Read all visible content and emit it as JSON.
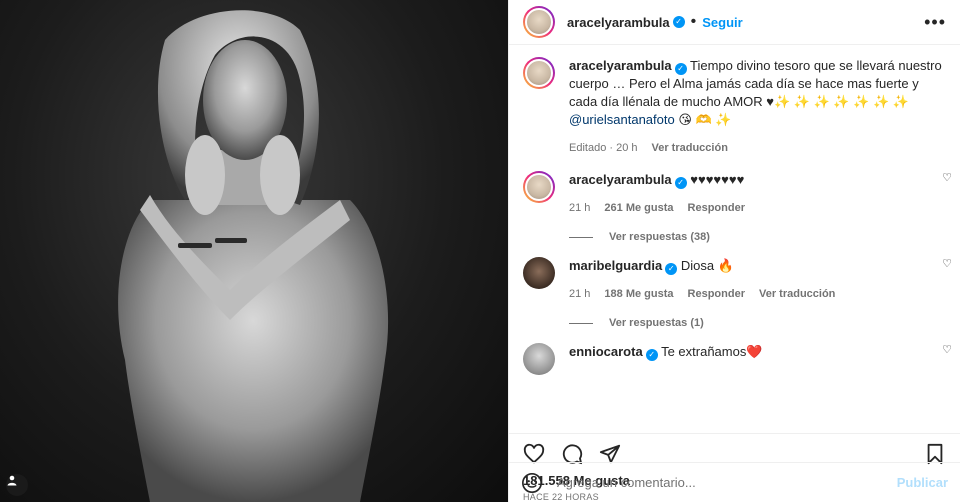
{
  "post": {
    "author": "aracelyarambula",
    "follow_label": "Seguir",
    "more_label": "•••"
  },
  "caption": {
    "author": "aracelyarambula",
    "text": "Tiempo divino tesoro que se llevará nuestro cuerpo … Pero el Alma jamás cada día se hace mas fuerte y cada día llénala de mucho AMOR ♥✨ ✨ ✨ ✨ ✨ ✨ ✨",
    "mention": "@urielsantanafoto",
    "emojis": " 😘 🫶 ✨",
    "edited": "Editado · 20 h",
    "translate": "Ver traducción"
  },
  "comments": [
    {
      "user": "aracelyarambula",
      "text": "♥♥♥♥♥♥♥",
      "time": "21 h",
      "likes": "261 Me gusta",
      "reply": "Responder",
      "translate": "",
      "replies": "Ver respuestas (38)"
    },
    {
      "user": "maribelguardia",
      "text": "Diosa 🔥",
      "time": "21 h",
      "likes": "188 Me gusta",
      "reply": "Responder",
      "translate": "Ver traducción",
      "replies": "Ver respuestas (1)"
    },
    {
      "user": "enniocarota",
      "text": "Te extrañamos❤️"
    }
  ],
  "stats": {
    "likes": "181.558 Me gusta",
    "time": "HACE 22 HORAS"
  },
  "composer": {
    "placeholder": "Agrega un comentario...",
    "publish": "Publicar"
  },
  "icons": {
    "like": "heart-icon",
    "comment": "comment-icon",
    "share": "share-icon",
    "save": "bookmark-icon",
    "emoji": "emoji-icon",
    "tag": "user-tag-icon"
  }
}
